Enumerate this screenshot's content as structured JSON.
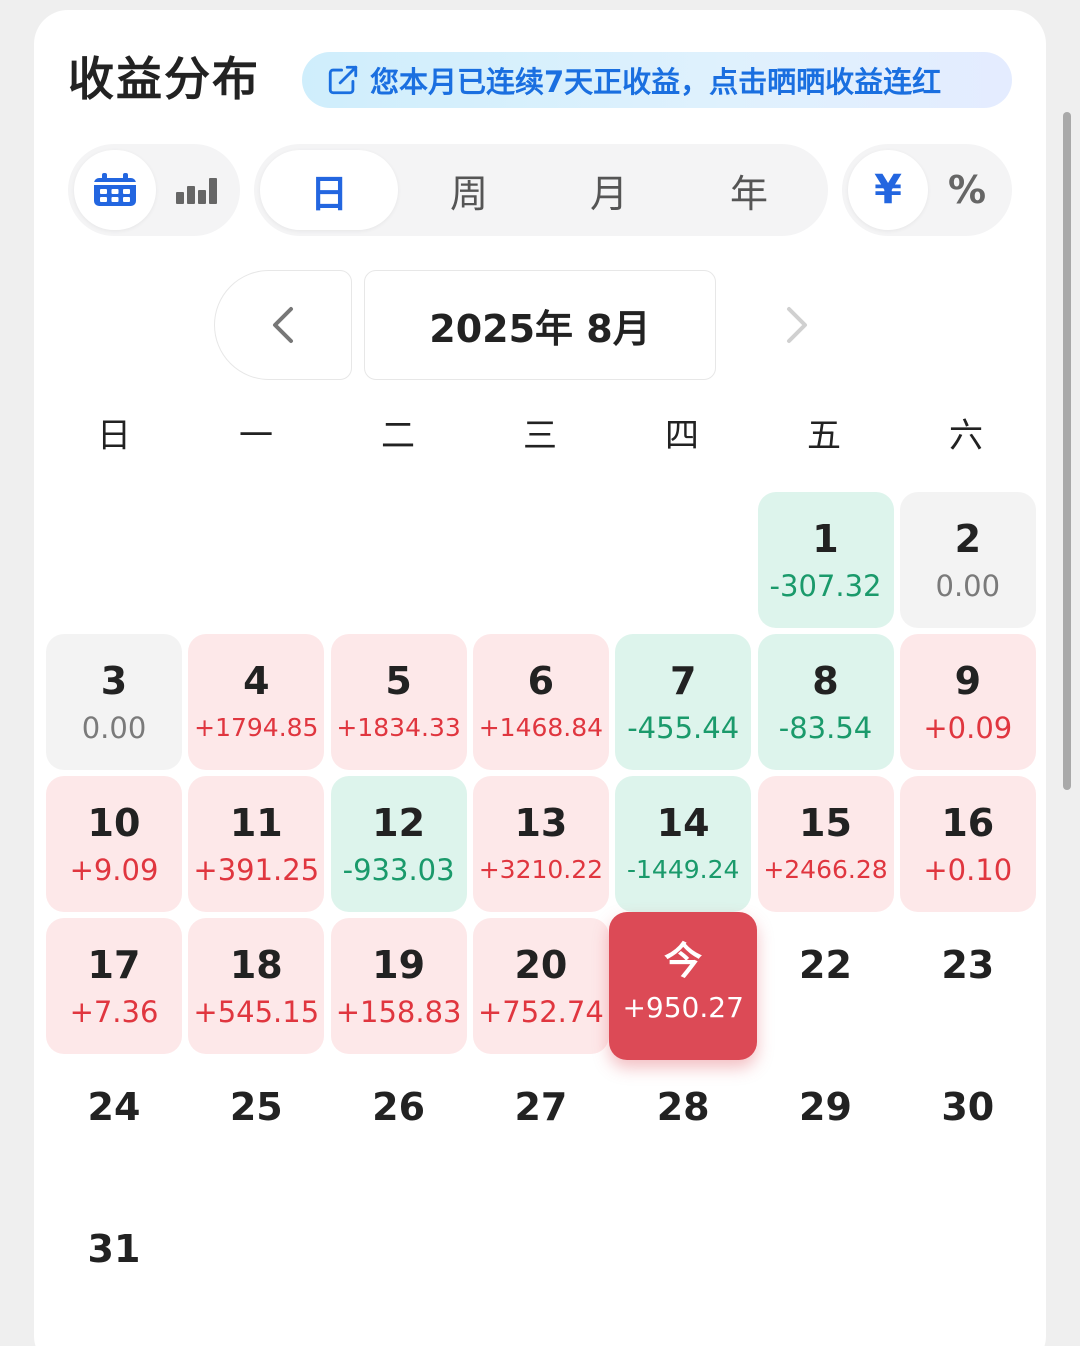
{
  "header": {
    "title": "收益分布",
    "banner_text": "您本月已连续7天正收益，点击晒晒收益连红"
  },
  "view_toggle": {
    "items": [
      {
        "icon": "calendar-icon",
        "active": true
      },
      {
        "icon": "bar-chart-icon",
        "active": false
      }
    ]
  },
  "period_tabs": [
    {
      "label": "日",
      "active": true
    },
    {
      "label": "周",
      "active": false
    },
    {
      "label": "月",
      "active": false
    },
    {
      "label": "年",
      "active": false
    }
  ],
  "unit_toggle": [
    {
      "label": "¥",
      "active": true
    },
    {
      "label": "%",
      "active": false
    }
  ],
  "month_nav": {
    "current": "2025年 8月",
    "prev_icon": "chevron-left-icon",
    "next_icon": "chevron-right-icon"
  },
  "weekdays": [
    "日",
    "一",
    "二",
    "三",
    "四",
    "五",
    "六"
  ],
  "calendar": {
    "first_weekday": 5,
    "days": [
      {
        "day": "1",
        "value": "-307.32",
        "status": "neg"
      },
      {
        "day": "2",
        "value": "0.00",
        "status": "zero"
      },
      {
        "day": "3",
        "value": "0.00",
        "status": "zero"
      },
      {
        "day": "4",
        "value": "+1794.85",
        "status": "pos"
      },
      {
        "day": "5",
        "value": "+1834.33",
        "status": "pos"
      },
      {
        "day": "6",
        "value": "+1468.84",
        "status": "pos"
      },
      {
        "day": "7",
        "value": "-455.44",
        "status": "neg"
      },
      {
        "day": "8",
        "value": "-83.54",
        "status": "neg"
      },
      {
        "day": "9",
        "value": "+0.09",
        "status": "pos"
      },
      {
        "day": "10",
        "value": "+9.09",
        "status": "pos"
      },
      {
        "day": "11",
        "value": "+391.25",
        "status": "pos"
      },
      {
        "day": "12",
        "value": "-933.03",
        "status": "neg"
      },
      {
        "day": "13",
        "value": "+3210.22",
        "status": "pos"
      },
      {
        "day": "14",
        "value": "-1449.24",
        "status": "neg"
      },
      {
        "day": "15",
        "value": "+2466.28",
        "status": "pos"
      },
      {
        "day": "16",
        "value": "+0.10",
        "status": "pos"
      },
      {
        "day": "17",
        "value": "+7.36",
        "status": "pos"
      },
      {
        "day": "18",
        "value": "+545.15",
        "status": "pos"
      },
      {
        "day": "19",
        "value": "+158.83",
        "status": "pos"
      },
      {
        "day": "20",
        "value": "+752.74",
        "status": "pos"
      },
      {
        "day": "今",
        "value": "+950.27",
        "status": "today"
      },
      {
        "day": "22",
        "value": "",
        "status": "future"
      },
      {
        "day": "23",
        "value": "",
        "status": "future"
      },
      {
        "day": "24",
        "value": "",
        "status": "future"
      },
      {
        "day": "25",
        "value": "",
        "status": "future"
      },
      {
        "day": "26",
        "value": "",
        "status": "future"
      },
      {
        "day": "27",
        "value": "",
        "status": "future"
      },
      {
        "day": "28",
        "value": "",
        "status": "future"
      },
      {
        "day": "29",
        "value": "",
        "status": "future"
      },
      {
        "day": "30",
        "value": "",
        "status": "future"
      },
      {
        "day": "31",
        "value": "",
        "status": "future"
      }
    ]
  },
  "colors": {
    "accent_blue": "#2366e0",
    "positive_red": "#e0363f",
    "negative_green": "#1a9a6b",
    "today_bg": "#dc4a56"
  }
}
